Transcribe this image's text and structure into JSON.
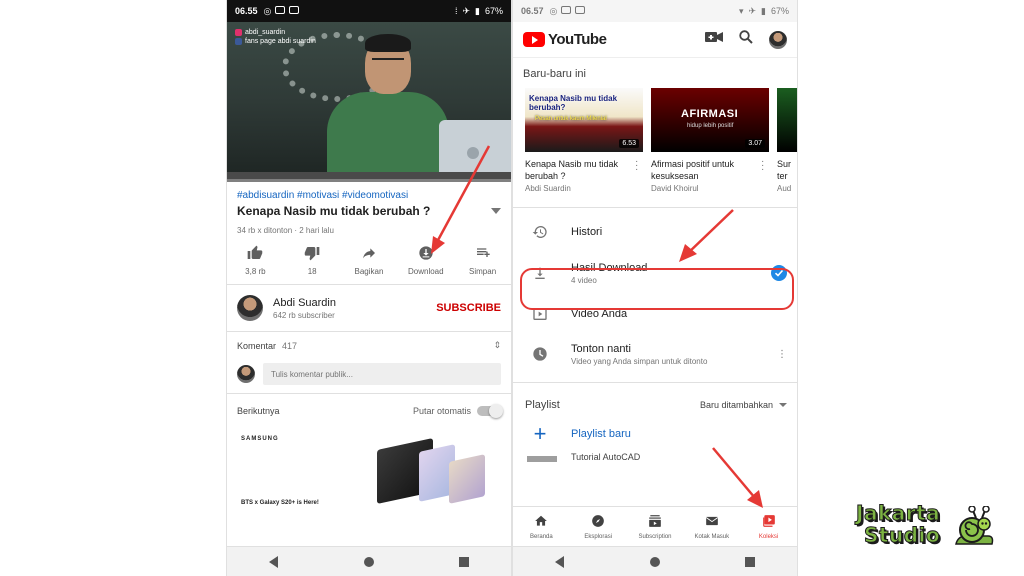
{
  "left": {
    "status": {
      "time": "06.55",
      "battery": "67%"
    },
    "video": {
      "overlay_line1": "abdi_suardin",
      "overlay_line2": "fans page abdi suardin",
      "progress": 0
    },
    "hashtags": "#abdisuardin #motivasi #videomotivasi",
    "title": "Kenapa Nasib mu tidak berubah ?",
    "meta": "34 rb x ditonton · 2 hari lalu",
    "actions": [
      {
        "label": "3,8 rb",
        "icon": "thumbs-up-icon"
      },
      {
        "label": "18",
        "icon": "thumbs-down-icon"
      },
      {
        "label": "Bagikan",
        "icon": "share-icon"
      },
      {
        "label": "Download",
        "icon": "download-icon"
      },
      {
        "label": "Simpan",
        "icon": "save-playlist-icon"
      }
    ],
    "channel": {
      "name": "Abdi Suardin",
      "subs": "642 rb subscriber",
      "subscribe": "SUBSCRIBE"
    },
    "comments": {
      "label": "Komentar",
      "count": "417",
      "placeholder": "Tulis komentar publik..."
    },
    "up_next": {
      "label": "Berikutnya",
      "autoplay": "Putar otomatis",
      "autoplay_on": false
    },
    "ad": {
      "brand": "SAMSUNG",
      "caption": "BTS x Galaxy S20+ is Here!"
    }
  },
  "right": {
    "status": {
      "time": "06.57",
      "battery": "67%"
    },
    "logo_text": "YouTube",
    "recent_title": "Baru-baru ini",
    "recent": [
      {
        "thumb_line1": "Kenapa Nasib mu tidak",
        "thumb_line2": "berubah?",
        "thumb_sub": "Pesan untuk kaum Milenial",
        "duration": "6.53",
        "title": "Kenapa Nasib mu tidak berubah ?",
        "author": "Abdi Suardin"
      },
      {
        "thumb_big": "AFIRMASI",
        "thumb_small": "hidup lebih positif",
        "duration": "3.07",
        "title": "Afirmasi positif untuk kesuksesan",
        "author": "David Khoirul"
      },
      {
        "title": "Sur",
        "title2": "ter",
        "author": "Aud"
      }
    ],
    "library": [
      {
        "label": "Histori",
        "sub": "",
        "icon": "history-icon"
      },
      {
        "label": "Hasil Download",
        "sub": "4 video",
        "icon": "download-icon",
        "checked": true
      },
      {
        "label": "Video Anda",
        "sub": "",
        "icon": "your-videos-icon"
      },
      {
        "label": "Tonton nanti",
        "sub": "Video yang Anda simpan untuk ditonto",
        "icon": "watch-later-icon"
      }
    ],
    "playlist": {
      "title": "Playlist",
      "sort": "Baru ditambahkan",
      "new_label": "Playlist baru",
      "peek_text": "Tutorial AutoCAD"
    },
    "bottom_nav": [
      {
        "label": "Beranda",
        "icon": "home-icon"
      },
      {
        "label": "Eksplorasi",
        "icon": "explore-icon"
      },
      {
        "label": "Subscription",
        "icon": "subscriptions-icon"
      },
      {
        "label": "Kotak Masuk",
        "icon": "inbox-icon"
      },
      {
        "label": "Koleksi",
        "icon": "library-icon",
        "active": true
      }
    ]
  },
  "brand": {
    "line1": "Jakarta",
    "line2": "Studio"
  },
  "colors": {
    "accent_red": "#cc0000",
    "link_blue": "#1565c0",
    "annotation_red": "#e53935",
    "brand_green": "#7cb342"
  }
}
